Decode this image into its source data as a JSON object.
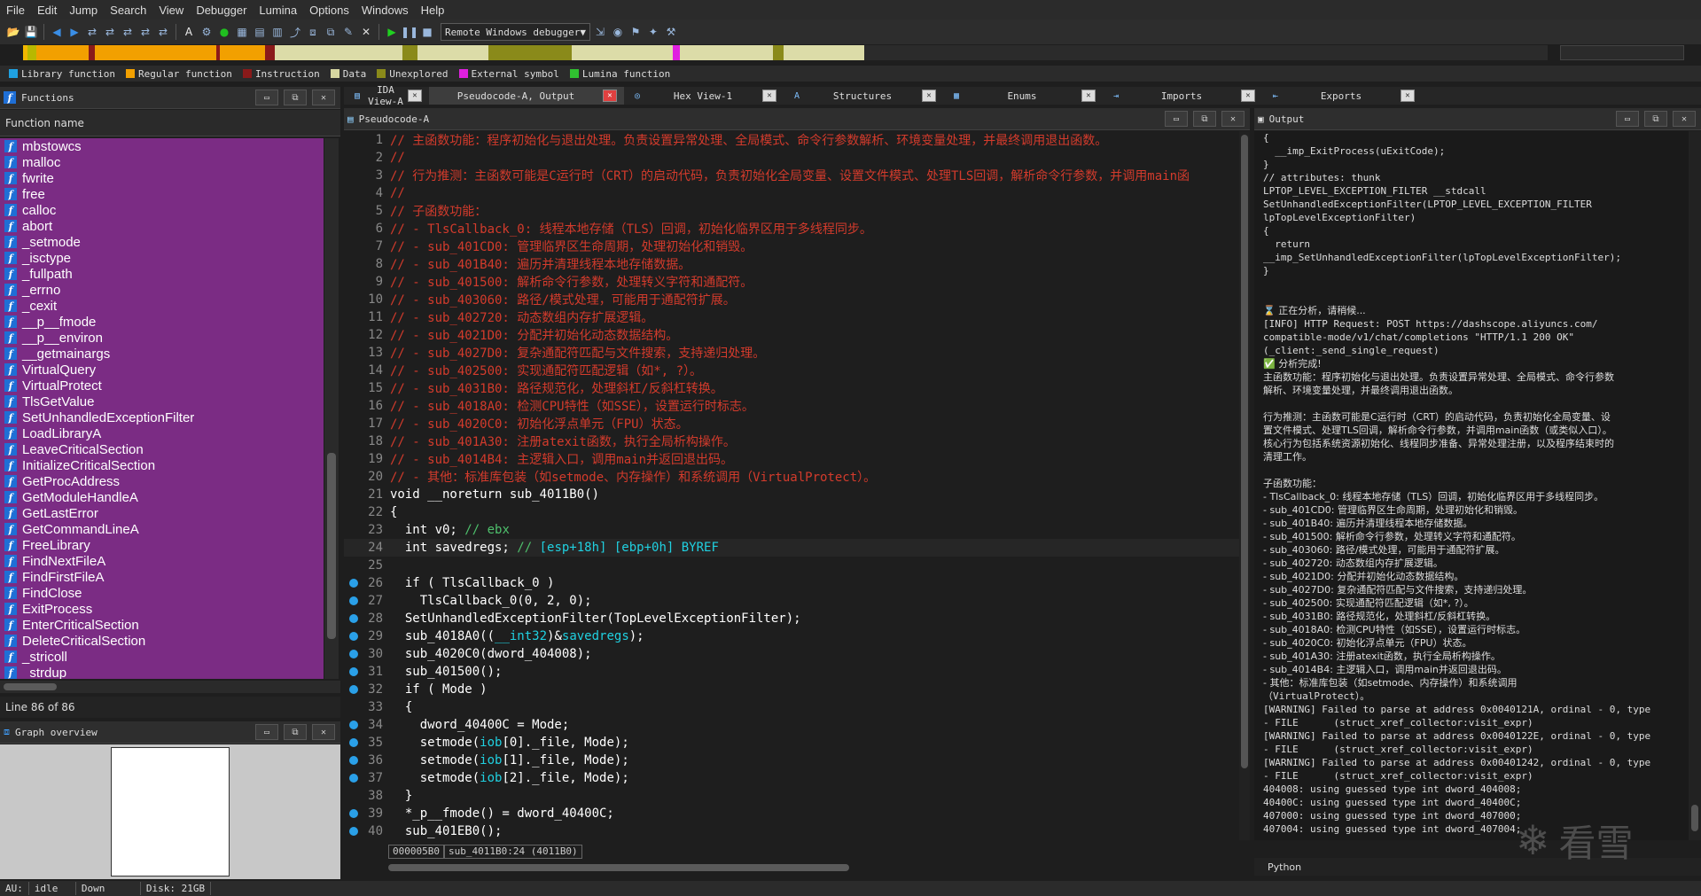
{
  "menu": [
    "File",
    "Edit",
    "Jump",
    "Search",
    "View",
    "Debugger",
    "Lumina",
    "Options",
    "Windows",
    "Help"
  ],
  "toolbar": {
    "debugger_label": "Remote Windows debugger",
    "icons": [
      "open-icon",
      "save-icon",
      "back-icon",
      "forward-icon",
      "nav-icon",
      "nav-icon",
      "nav-icon",
      "nav-icon",
      "nav-icon",
      "text-icon",
      "assembler-icon",
      "run-icon",
      "code-icon",
      "data-icon",
      "struct-icon",
      "xref-icon",
      "graph-icon",
      "graph2-icon",
      "patch-icon",
      "delete-icon",
      "play-icon",
      "pause-icon",
      "stop-icon",
      "attach-icon",
      "breakpoint-icon",
      "trace-icon",
      "lumina-icon",
      "tool-icon"
    ]
  },
  "navband": {
    "segments": [
      {
        "start": 0.0,
        "end": 0.003,
        "color": "#f2b700"
      },
      {
        "start": 0.003,
        "end": 0.009,
        "color": "#b8b800"
      },
      {
        "start": 0.009,
        "end": 0.043,
        "color": "#f2a000"
      },
      {
        "start": 0.043,
        "end": 0.047,
        "color": "#8a1a1a"
      },
      {
        "start": 0.047,
        "end": 0.127,
        "color": "#f2a000"
      },
      {
        "start": 0.127,
        "end": 0.129,
        "color": "#8a1a1a"
      },
      {
        "start": 0.129,
        "end": 0.159,
        "color": "#f2a000"
      },
      {
        "start": 0.159,
        "end": 0.165,
        "color": "#8a1a1a"
      },
      {
        "start": 0.165,
        "end": 0.249,
        "color": "#dcdca8"
      },
      {
        "start": 0.249,
        "end": 0.259,
        "color": "#8a8a1a"
      },
      {
        "start": 0.259,
        "end": 0.305,
        "color": "#dcdca8"
      },
      {
        "start": 0.305,
        "end": 0.36,
        "color": "#8a8a1a"
      },
      {
        "start": 0.36,
        "end": 0.426,
        "color": "#dcdca8"
      },
      {
        "start": 0.426,
        "end": 0.431,
        "color": "#e020e0"
      },
      {
        "start": 0.431,
        "end": 0.492,
        "color": "#dcdca8"
      },
      {
        "start": 0.492,
        "end": 0.499,
        "color": "#8a8a1a"
      },
      {
        "start": 0.499,
        "end": 0.552,
        "color": "#dcdca8"
      },
      {
        "start": 0.552,
        "end": 1.0,
        "color": "#2b2b2b"
      }
    ]
  },
  "legend": [
    {
      "label": "Library function",
      "color": "#1fa0e0"
    },
    {
      "label": "Regular function",
      "color": "#f2a000"
    },
    {
      "label": "Instruction",
      "color": "#8a1a1a"
    },
    {
      "label": "Data",
      "color": "#d6d6a0"
    },
    {
      "label": "Unexplored",
      "color": "#8a8a1a"
    },
    {
      "label": "External symbol",
      "color": "#e020e0"
    },
    {
      "label": "Lumina function",
      "color": "#30c030"
    }
  ],
  "functions": {
    "title": "Functions",
    "column_header": "Function name",
    "items": [
      "mbstowcs",
      "malloc",
      "fwrite",
      "free",
      "calloc",
      "abort",
      "_setmode",
      "_isctype",
      "_fullpath",
      "_errno",
      "_cexit",
      "__p__fmode",
      "__p__environ",
      "__getmainargs",
      "VirtualQuery",
      "VirtualProtect",
      "TlsGetValue",
      "SetUnhandledExceptionFilter",
      "LoadLibraryA",
      "LeaveCriticalSection",
      "InitializeCriticalSection",
      "GetProcAddress",
      "GetModuleHandleA",
      "GetLastError",
      "GetCommandLineA",
      "FreeLibrary",
      "FindNextFileA",
      "FindFirstFileA",
      "FindClose",
      "ExitProcess",
      "EnterCriticalSection",
      "DeleteCriticalSection",
      "_stricoll",
      "_strdup"
    ],
    "status": "Line 86 of 86"
  },
  "graph_overview": {
    "title": "Graph overview"
  },
  "tabs": [
    {
      "label": "IDA View-A",
      "icon": "ida-view-icon",
      "active": false
    },
    {
      "label": "Pseudocode-A, Output",
      "icon": "",
      "active": true
    },
    {
      "label": "Hex View-1",
      "icon": "hex-icon",
      "active": false
    },
    {
      "label": "Structures",
      "icon": "structures-icon",
      "active": false
    },
    {
      "label": "Enums",
      "icon": "enums-icon",
      "active": false
    },
    {
      "label": "Imports",
      "icon": "imports-icon",
      "active": false
    },
    {
      "label": "Exports",
      "icon": "exports-icon",
      "active": false
    }
  ],
  "pseudocode": {
    "title": "Pseudocode-A",
    "status_addr": "000005B0",
    "status_loc": "sub_4011B0:24 (4011B0)",
    "lines": [
      {
        "n": "1",
        "dot": false,
        "hl": false,
        "parts": [
          [
            "c",
            "// 主函数功能：程序初始化与退出处理。负责设置异常处理、全局模式、命令行参数解析、环境变量处理，并最终调用退出函数。"
          ]
        ]
      },
      {
        "n": "2",
        "dot": false,
        "hl": false,
        "parts": [
          [
            "c",
            "//"
          ]
        ]
      },
      {
        "n": "3",
        "dot": false,
        "hl": false,
        "parts": [
          [
            "c",
            "// 行为推测：主函数可能是C运行时（CRT）的启动代码，负责初始化全局变量、设置文件模式、处理TLS回调，解析命令行参数，并调用main函"
          ]
        ]
      },
      {
        "n": "4",
        "dot": false,
        "hl": false,
        "parts": [
          [
            "c",
            "//"
          ]
        ]
      },
      {
        "n": "5",
        "dot": false,
        "hl": false,
        "parts": [
          [
            "c",
            "// 子函数功能："
          ]
        ]
      },
      {
        "n": "6",
        "dot": false,
        "hl": false,
        "parts": [
          [
            "c",
            "// - TlsCallback_0: 线程本地存储（TLS）回调，初始化临界区用于多线程同步。"
          ]
        ]
      },
      {
        "n": "7",
        "dot": false,
        "hl": false,
        "parts": [
          [
            "c",
            "// - sub_401CD0: 管理临界区生命周期，处理初始化和销毁。"
          ]
        ]
      },
      {
        "n": "8",
        "dot": false,
        "hl": false,
        "parts": [
          [
            "c",
            "// - sub_401B40: 遍历并清理线程本地存储数据。"
          ]
        ]
      },
      {
        "n": "9",
        "dot": false,
        "hl": false,
        "parts": [
          [
            "c",
            "// - sub_401500: 解析命令行参数，处理转义字符和通配符。"
          ]
        ]
      },
      {
        "n": "10",
        "dot": false,
        "hl": false,
        "parts": [
          [
            "c",
            "// - sub_403060: 路径/模式处理，可能用于通配符扩展。"
          ]
        ]
      },
      {
        "n": "11",
        "dot": false,
        "hl": false,
        "parts": [
          [
            "c",
            "// - sub_402720: 动态数组内存扩展逻辑。"
          ]
        ]
      },
      {
        "n": "12",
        "dot": false,
        "hl": false,
        "parts": [
          [
            "c",
            "// - sub_4021D0: 分配并初始化动态数据结构。"
          ]
        ]
      },
      {
        "n": "13",
        "dot": false,
        "hl": false,
        "parts": [
          [
            "c",
            "// - sub_4027D0: 复杂通配符匹配与文件搜索，支持递归处理。"
          ]
        ]
      },
      {
        "n": "14",
        "dot": false,
        "hl": false,
        "parts": [
          [
            "c",
            "// - sub_402500: 实现通配符匹配逻辑（如*, ?）。"
          ]
        ]
      },
      {
        "n": "15",
        "dot": false,
        "hl": false,
        "parts": [
          [
            "c",
            "// - sub_4031B0: 路径规范化，处理斜杠/反斜杠转换。"
          ]
        ]
      },
      {
        "n": "16",
        "dot": false,
        "hl": false,
        "parts": [
          [
            "c",
            "// - sub_4018A0: 检测CPU特性（如SSE），设置运行时标志。"
          ]
        ]
      },
      {
        "n": "17",
        "dot": false,
        "hl": false,
        "parts": [
          [
            "c",
            "// - sub_4020C0: 初始化浮点单元（FPU）状态。"
          ]
        ]
      },
      {
        "n": "18",
        "dot": false,
        "hl": false,
        "parts": [
          [
            "c",
            "// - sub_401A30: 注册atexit函数，执行全局析构操作。"
          ]
        ]
      },
      {
        "n": "19",
        "dot": false,
        "hl": false,
        "parts": [
          [
            "c",
            "// - sub_4014B4: 主逻辑入口，调用main并返回退出码。"
          ]
        ]
      },
      {
        "n": "20",
        "dot": false,
        "hl": false,
        "parts": [
          [
            "c",
            "// - 其他：标准库包装（如setmode、内存操作）和系统调用（VirtualProtect）。"
          ]
        ]
      },
      {
        "n": "21",
        "dot": false,
        "hl": false,
        "parts": [
          [
            "k",
            "void __noreturn sub_4011B0()"
          ]
        ]
      },
      {
        "n": "22",
        "dot": false,
        "hl": false,
        "parts": [
          [
            "k",
            "{"
          ]
        ]
      },
      {
        "n": "23",
        "dot": false,
        "hl": false,
        "parts": [
          [
            "k",
            "  int v0; "
          ],
          [
            "gc",
            "// ebx"
          ]
        ]
      },
      {
        "n": "24",
        "dot": false,
        "hl": true,
        "parts": [
          [
            "k",
            "  int savedregs; "
          ],
          [
            "gc",
            "// "
          ],
          [
            "cyan",
            "[esp+18h] [ebp+0h] BYREF"
          ]
        ]
      },
      {
        "n": "25",
        "dot": false,
        "hl": false,
        "parts": [
          [
            "k",
            ""
          ]
        ]
      },
      {
        "n": "26",
        "dot": true,
        "hl": false,
        "parts": [
          [
            "k",
            "  if ( TlsCallback_0 )"
          ]
        ]
      },
      {
        "n": "27",
        "dot": true,
        "hl": false,
        "parts": [
          [
            "k",
            "    TlsCallback_0(0, 2, 0);"
          ]
        ]
      },
      {
        "n": "28",
        "dot": true,
        "hl": false,
        "parts": [
          [
            "k",
            "  SetUnhandledExceptionFilter(TopLevelExceptionFilter);"
          ]
        ]
      },
      {
        "n": "29",
        "dot": true,
        "hl": false,
        "parts": [
          [
            "k",
            "  sub_4018A0(("
          ],
          [
            "cyan",
            "__int32"
          ],
          [
            "k",
            ")&"
          ],
          [
            "cyan",
            "savedregs"
          ],
          [
            "k",
            ");"
          ]
        ]
      },
      {
        "n": "30",
        "dot": true,
        "hl": false,
        "parts": [
          [
            "k",
            "  sub_4020C0(dword_404008);"
          ]
        ]
      },
      {
        "n": "31",
        "dot": true,
        "hl": false,
        "parts": [
          [
            "k",
            "  sub_401500();"
          ]
        ]
      },
      {
        "n": "32",
        "dot": true,
        "hl": false,
        "parts": [
          [
            "k",
            "  if ( Mode )"
          ]
        ]
      },
      {
        "n": "33",
        "dot": false,
        "hl": false,
        "parts": [
          [
            "k",
            "  {"
          ]
        ]
      },
      {
        "n": "34",
        "dot": true,
        "hl": false,
        "parts": [
          [
            "k",
            "    dword_40400C = Mode;"
          ]
        ]
      },
      {
        "n": "35",
        "dot": true,
        "hl": false,
        "parts": [
          [
            "k",
            "    setmode("
          ],
          [
            "cyan",
            "iob"
          ],
          [
            "k",
            "[0]._file, Mode);"
          ]
        ]
      },
      {
        "n": "36",
        "dot": true,
        "hl": false,
        "parts": [
          [
            "k",
            "    setmode("
          ],
          [
            "cyan",
            "iob"
          ],
          [
            "k",
            "[1]._file, Mode);"
          ]
        ]
      },
      {
        "n": "37",
        "dot": true,
        "hl": false,
        "parts": [
          [
            "k",
            "    setmode("
          ],
          [
            "cyan",
            "iob"
          ],
          [
            "k",
            "[2]._file, Mode);"
          ]
        ]
      },
      {
        "n": "38",
        "dot": false,
        "hl": false,
        "parts": [
          [
            "k",
            "  }"
          ]
        ]
      },
      {
        "n": "39",
        "dot": true,
        "hl": false,
        "parts": [
          [
            "k",
            "  *_p__fmode() = dword_40400C;"
          ]
        ]
      },
      {
        "n": "40",
        "dot": true,
        "hl": false,
        "parts": [
          [
            "k",
            "  sub_401EB0();"
          ]
        ]
      }
    ]
  },
  "output": {
    "title": "Output",
    "lines": [
      "{",
      "  __imp_ExitProcess(uExitCode);",
      "}",
      "// attributes: thunk",
      "LPTOP_LEVEL_EXCEPTION_FILTER __stdcall",
      "SetUnhandledExceptionFilter(LPTOP_LEVEL_EXCEPTION_FILTER",
      "lpTopLevelExceptionFilter)",
      "{",
      "  return",
      "__imp_SetUnhandledExceptionFilter(lpTopLevelExceptionFilter);",
      "}",
      "",
      "",
      "⌛ 正在分析，请稍候...",
      "[INFO] HTTP Request: POST https://dashscope.aliyuncs.com/",
      "compatible-mode/v1/chat/completions \"HTTP/1.1 200 OK\"",
      "(_client:_send_single_request)",
      "✅ 分析完成!",
      "主函数功能：程序初始化与退出处理。负责设置异常处理、全局模式、命令行参数",
      "解析、环境变量处理，并最终调用退出函数。",
      "",
      "行为推测：主函数可能是C运行时（CRT）的启动代码，负责初始化全局变量、设",
      "置文件模式、处理TLS回调，解析命令行参数，并调用main函数（或类似入口）。",
      "核心行为包括系统资源初始化、线程同步准备、异常处理注册，以及程序结束时的",
      "清理工作。",
      "",
      "子函数功能：",
      "- TlsCallback_0: 线程本地存储（TLS）回调，初始化临界区用于多线程同步。",
      "- sub_401CD0: 管理临界区生命周期，处理初始化和销毁。",
      "- sub_401B40: 遍历并清理线程本地存储数据。",
      "- sub_401500: 解析命令行参数，处理转义字符和通配符。",
      "- sub_403060: 路径/模式处理，可能用于通配符扩展。",
      "- sub_402720: 动态数组内存扩展逻辑。",
      "- sub_4021D0: 分配并初始化动态数据结构。",
      "- sub_4027D0: 复杂通配符匹配与文件搜索，支持递归处理。",
      "- sub_402500: 实现通配符匹配逻辑（如*, ?）。",
      "- sub_4031B0: 路径规范化，处理斜杠/反斜杠转换。",
      "- sub_4018A0: 检测CPU特性（如SSE），设置运行时标志。",
      "- sub_4020C0: 初始化浮点单元（FPU）状态。",
      "- sub_401A30: 注册atexit函数，执行全局析构操作。",
      "- sub_4014B4: 主逻辑入口，调用main并返回退出码。",
      "- 其他：标准库包装（如setmode、内存操作）和系统调用",
      "（VirtualProtect）。",
      "[WARNING] Failed to parse at address 0x0040121A, ordinal - 0, type",
      "- FILE      (struct_xref_collector:visit_expr)",
      "[WARNING] Failed to parse at address 0x0040122E, ordinal - 0, type",
      "- FILE      (struct_xref_collector:visit_expr)",
      "[WARNING] Failed to parse at address 0x00401242, ordinal - 0, type",
      "- FILE      (struct_xref_collector:visit_expr)",
      "404008: using guessed type int dword_404008;",
      "40400C: using guessed type int dword_40400C;",
      "407000: using guessed type int dword_407000;",
      "407004: using guessed type int dword_407004;"
    ]
  },
  "python_label": "Python",
  "statusbar": {
    "au": "AU:",
    "state": "idle",
    "direction": "Down",
    "disk": "Disk: 21GB"
  },
  "watermark": "看雪"
}
